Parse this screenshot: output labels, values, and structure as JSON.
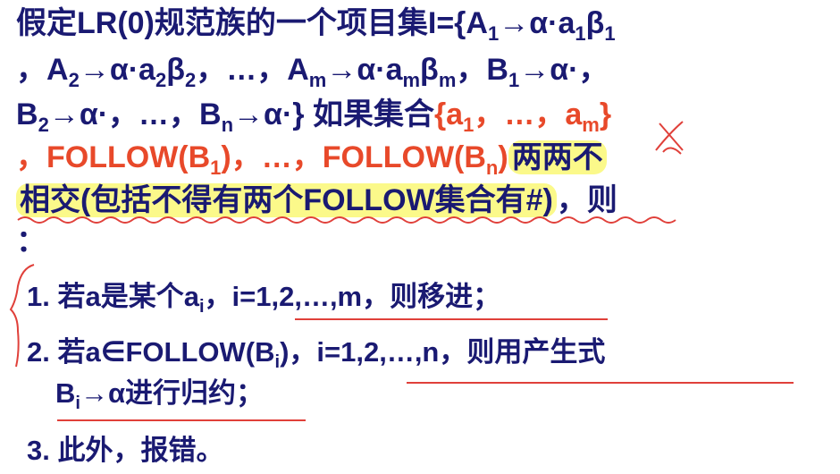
{
  "slide": {
    "l1": {
      "a": "假定LR(0)规范族的一个项目集I={A",
      "s1": "1",
      "b": "→α·a",
      "s2": "1",
      "c": "β",
      "s3": "1"
    },
    "l2": {
      "a": "，A",
      "s1": "2",
      "b": "→α·a",
      "s2": "2",
      "c": "β",
      "s3": "2",
      "d": "，…，A",
      "s4": "m",
      "e": "→α·a",
      "s5": "m",
      "f": "β",
      "s6": "m",
      "g": "，B",
      "s7": "1",
      "h": "→α·，"
    },
    "l3": {
      "a": "B",
      "s1": "2",
      "b": "→α·，…，B",
      "s2": "n",
      "c": "→α·} 如果集合",
      "d": "{a",
      "s3": "1",
      "e": "，…，a",
      "s4": "m",
      "f": "}"
    },
    "l4": {
      "a": "，FOLLOW(B",
      "s1": "1",
      "b": ")，…，FOLLOW(B",
      "s2": "n",
      "c": ")",
      "d": "两两不"
    },
    "l5": {
      "a": "相交(包括不得有两个FOLLOW集合有#)",
      "b": "，则"
    },
    "l6": {
      "a": "："
    }
  },
  "rules": [
    {
      "a": "1. 若a是某个a",
      "s1": "i",
      "b": "，i=1,2,…,m，则移进；"
    },
    {
      "a": "2. 若a∈FOLLOW(B",
      "s1": "i",
      "b": ")，i=1,2,…,n，则用产生式",
      "c": "B",
      "s2": "i",
      "d": "→α进行归约；"
    },
    {
      "a": "3. 此外，报错。"
    }
  ],
  "colors": {
    "text": "#1a1a72",
    "accent": "#e8492a",
    "highlight": "#fbf98a",
    "annotation": "#e0403a"
  }
}
